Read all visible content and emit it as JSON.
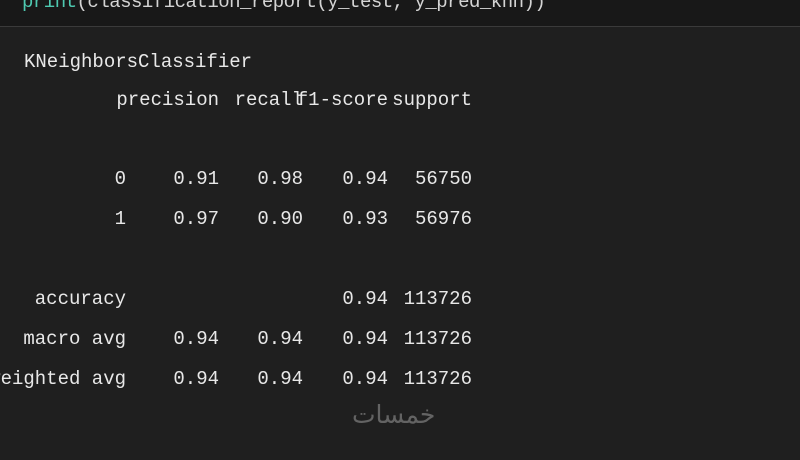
{
  "code_cell": {
    "func": "print",
    "args": "(classification_report(y_test, y_pred_knn))"
  },
  "output": {
    "classifier": "KNeighborsClassifier",
    "header": {
      "label": "",
      "precision": "precision",
      "recall": "recall",
      "f1": "f1-score",
      "support": "support"
    },
    "rows": [
      {
        "label": "0",
        "precision": "0.91",
        "recall": "0.98",
        "f1": "0.94",
        "support": "56750"
      },
      {
        "label": "1",
        "precision": "0.97",
        "recall": "0.90",
        "f1": "0.93",
        "support": "56976"
      },
      {
        "label": "accuracy",
        "precision": "",
        "recall": "",
        "f1": "0.94",
        "support": "113726"
      },
      {
        "label": "macro avg",
        "precision": "0.94",
        "recall": "0.94",
        "f1": "0.94",
        "support": "113726"
      },
      {
        "label": "weighted avg",
        "precision": "0.94",
        "recall": "0.94",
        "f1": "0.94",
        "support": "113726"
      }
    ]
  },
  "watermark": "خمسات"
}
